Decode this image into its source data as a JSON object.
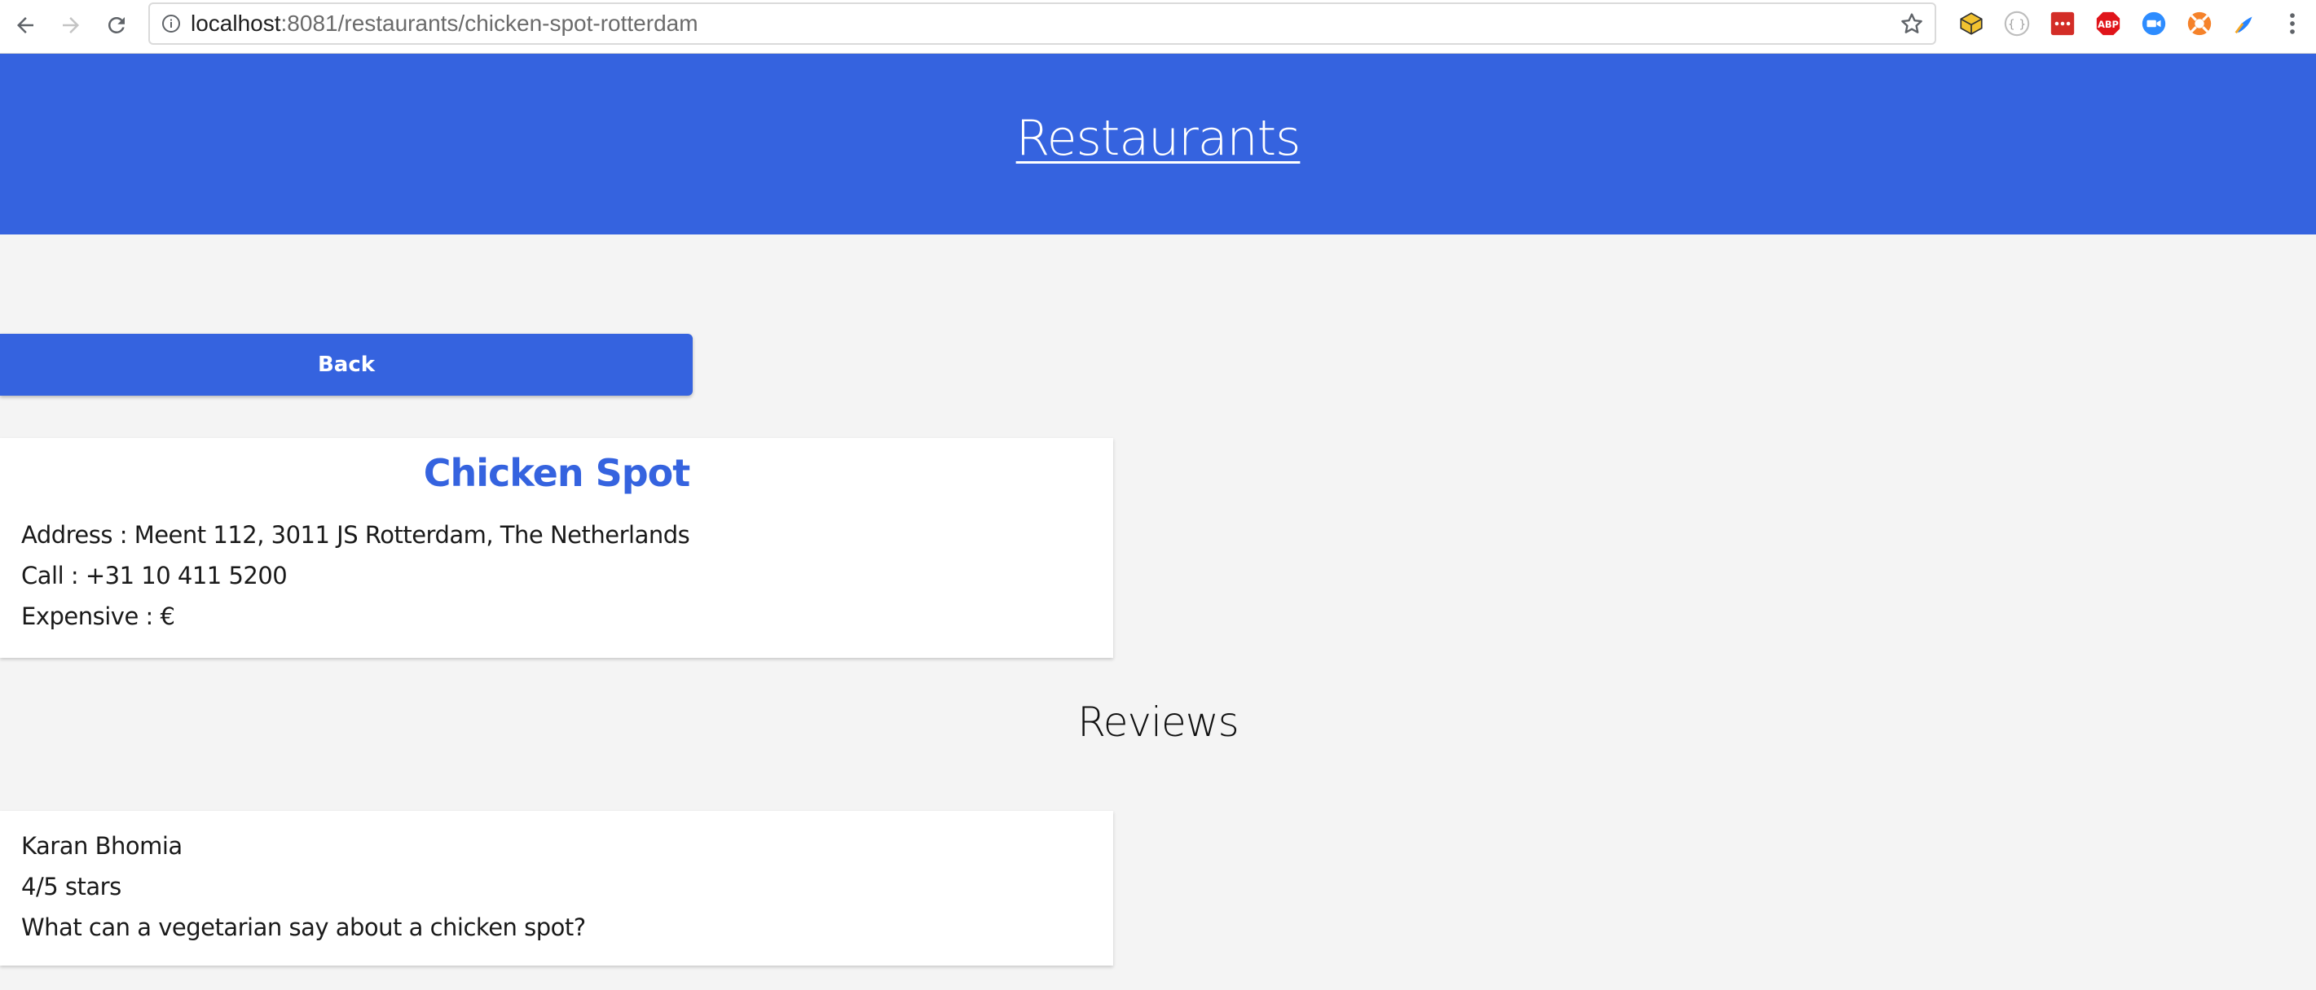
{
  "browser": {
    "url_host": "localhost",
    "url_rest": ":8081/restaurants/chicken-spot-rotterdam",
    "icons": {
      "back": "arrow-left-icon",
      "forward": "arrow-right-icon",
      "reload": "reload-icon",
      "info": "info-circle-icon",
      "bookmark": "star-icon"
    },
    "extensions": [
      {
        "name": "cube-extension-icon",
        "color": "#f2c230"
      },
      {
        "name": "json-extension-icon",
        "color": "#bdbdbd"
      },
      {
        "name": "lastpass-extension-icon",
        "color": "#d32d27"
      },
      {
        "name": "adblock-extension-icon",
        "color": "#e0141a",
        "label": "ABP"
      },
      {
        "name": "zoom-extension-icon",
        "color": "#2d8cff"
      },
      {
        "name": "lifesaver-extension-icon",
        "color": "#f5822a"
      },
      {
        "name": "jira-extension-icon",
        "color": "#2684ff"
      }
    ]
  },
  "header": {
    "title": "Restaurants",
    "color": "#3563df"
  },
  "back_button": {
    "label": "Back"
  },
  "restaurant": {
    "name": "Chicken Spot",
    "address": "Address : Meent 112, 3011 JS Rotterdam, The Netherlands",
    "phone": "Call : +31 10 411 5200",
    "price": "Expensive : €"
  },
  "reviews": {
    "heading": "Reviews",
    "items": [
      {
        "author": "Karan Bhomia",
        "rating": "4/5 stars",
        "text": "What can a vegetarian say about a chicken spot?"
      }
    ]
  }
}
